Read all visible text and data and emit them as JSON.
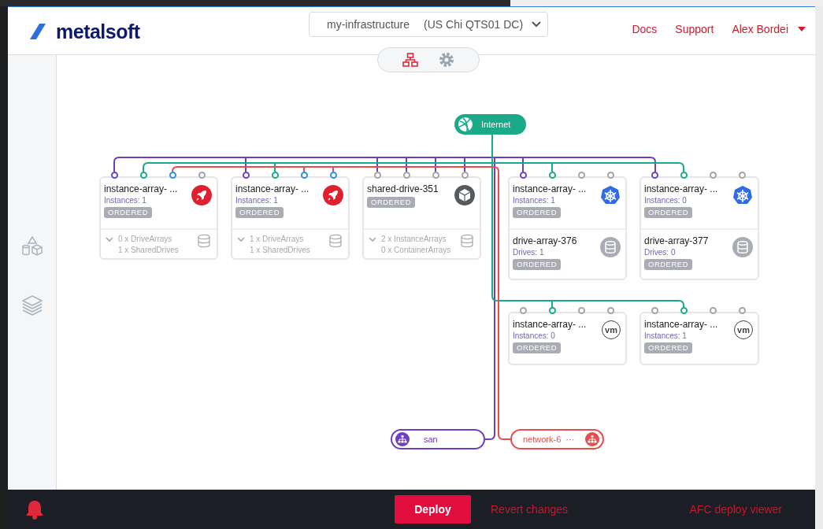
{
  "header": {
    "logo": "metalsoft",
    "infrastructure_select": {
      "name": "my-infrastructure",
      "datacenter": "(US Chi QTS01 DC)"
    },
    "links": [
      "Docs",
      "Support"
    ],
    "user": {
      "name": "Alex Bordei"
    }
  },
  "view_tabs": [
    {
      "kind": "diagram",
      "selected": true
    },
    {
      "kind": "settings",
      "selected": false
    }
  ],
  "sidebar": {
    "items": [
      {
        "kind": "resources"
      },
      {
        "kind": "layers"
      }
    ]
  },
  "networks": [
    {
      "kind": "internet",
      "label": "Internet",
      "color": "#1aaa8a"
    },
    {
      "kind": "san",
      "label": "san",
      "color": "#6f3fc0"
    },
    {
      "kind": "lan",
      "label": "network-6",
      "more": "···",
      "color": "#e84c4c"
    }
  ],
  "cards": [
    {
      "kind": "bare_metal",
      "title": "instance-array- ...",
      "detail": "Instances: 1",
      "status": "ORDERED",
      "ports": [
        {
          "color": "#6f3fc0"
        },
        {
          "color": "#1aaa8a"
        },
        {
          "color": "#2b8fe8"
        },
        {
          "color": "#a0a4a8"
        }
      ],
      "footer": [
        "0 x DriveArrays",
        "1 x SharedDrives"
      ]
    },
    {
      "kind": "bare_metal",
      "title": "instance-array- ...",
      "detail": "Instances: 1",
      "status": "ORDERED",
      "ports": [
        {
          "color": "#6f3fc0"
        },
        {
          "color": "#1aaa8a"
        },
        {
          "color": "#2b8fe8"
        },
        {
          "color": "#2b8fe8"
        }
      ],
      "footer": [
        "1 x DriveArrays",
        "1 x SharedDrives"
      ]
    },
    {
      "kind": "shared_drive",
      "title": "shared-drive-351",
      "status": "ORDERED",
      "ports": [
        {
          "color": "#a0a4a8"
        },
        {
          "color": "#a0a4a8"
        },
        {
          "color": "#a0a4a8"
        },
        {
          "color": "#a0a4a8"
        }
      ],
      "footer": [
        "2 x InstanceArrays",
        "0 x ContainerArrays"
      ]
    },
    {
      "kind": "kubernetes",
      "title": "instance-array- ...",
      "detail": "Instances: 1",
      "status": "ORDERED",
      "ports": [
        {
          "color": "#6f3fc0"
        },
        {
          "color": "#1aaa8a"
        },
        {
          "color": "#a0a4a8"
        },
        {
          "color": "#a0a4a8"
        }
      ],
      "drive_array": {
        "title": "drive-array-376",
        "detail": "Drives: 1",
        "status": "ORDERED"
      }
    },
    {
      "kind": "kubernetes",
      "title": "instance-array- ...",
      "detail": "Instances: 0",
      "status": "ORDERED",
      "ports": [
        {
          "color": "#6f3fc0"
        },
        {
          "color": "#1aaa8a"
        },
        {
          "color": "#a0a4a8"
        },
        {
          "color": "#a0a4a8"
        }
      ],
      "drive_array": {
        "title": "drive-array-377",
        "detail": "Drives: 0",
        "status": "ORDERED"
      }
    },
    {
      "kind": "vmware",
      "title": "instance-array- ...",
      "detail": "Instances: 0",
      "status": "ORDERED",
      "logo_text": "vm",
      "ports": [
        {
          "color": "#a0a4a8"
        },
        {
          "color": "#1aaa8a"
        },
        {
          "color": "#a0a4a8"
        },
        {
          "color": "#a0a4a8"
        }
      ]
    },
    {
      "kind": "vmware",
      "title": "instance-array- ...",
      "detail": "Instances: 1",
      "status": "ORDERED",
      "logo_text": "vm",
      "ports": [
        {
          "color": "#a0a4a8"
        },
        {
          "color": "#1aaa8a"
        },
        {
          "color": "#a0a4a8"
        },
        {
          "color": "#a0a4a8"
        }
      ]
    }
  ],
  "footer": {
    "deploy": "Deploy",
    "revert": "Revert changes",
    "viewer": "AFC deploy viewer"
  }
}
